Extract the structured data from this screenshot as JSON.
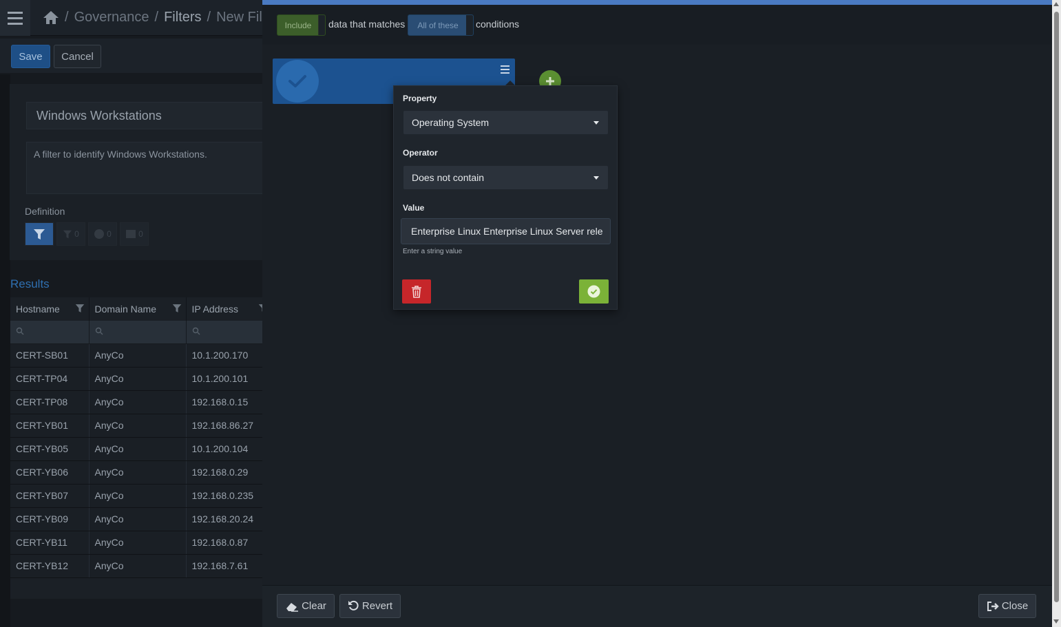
{
  "breadcrumb": {
    "items": [
      "Governance",
      "Filters",
      "New Fil"
    ],
    "separator": "/"
  },
  "toolbar": {
    "save_label": "Save",
    "cancel_label": "Cancel"
  },
  "filter": {
    "name": "Windows Workstations",
    "description": "A filter to identify Windows Workstations.",
    "definition_label": "Definition",
    "tab_counts": [
      "0",
      "0",
      "0"
    ]
  },
  "results": {
    "title": "Results",
    "columns": [
      "Hostname",
      "Domain Name",
      "IP Address"
    ],
    "rows": [
      [
        "CERT-SB01",
        "AnyCo",
        "10.1.200.170"
      ],
      [
        "CERT-TP04",
        "AnyCo",
        "10.1.200.101"
      ],
      [
        "CERT-TP08",
        "AnyCo",
        "192.168.0.15"
      ],
      [
        "CERT-YB01",
        "AnyCo",
        "192.168.86.27"
      ],
      [
        "CERT-YB05",
        "AnyCo",
        "10.1.200.104"
      ],
      [
        "CERT-YB06",
        "AnyCo",
        "192.168.0.29"
      ],
      [
        "CERT-YB07",
        "AnyCo",
        "192.168.0.235"
      ],
      [
        "CERT-YB09",
        "AnyCo",
        "192.168.20.24"
      ],
      [
        "CERT-YB11",
        "AnyCo",
        "192.168.0.87"
      ],
      [
        "CERT-YB12",
        "AnyCo",
        "192.168.7.61"
      ]
    ]
  },
  "editor": {
    "include_label": "Include",
    "text_matches": "data that matches",
    "match_mode_label": "All of these",
    "text_conditions": "conditions",
    "condition": {
      "property_label": "Property",
      "property_value": "Operating System",
      "operator_label": "Operator",
      "operator_value": "Does not contain",
      "value_label": "Value",
      "value_text": "Enterprise Linux Enterprise Linux Server rele",
      "value_help": "Enter a string value"
    },
    "footer": {
      "clear_label": "Clear",
      "revert_label": "Revert",
      "close_label": "Close"
    }
  },
  "colors": {
    "primary": "#1c5290",
    "include_green": "#3c5e2a",
    "danger": "#c6262a",
    "success": "#7bb238"
  }
}
